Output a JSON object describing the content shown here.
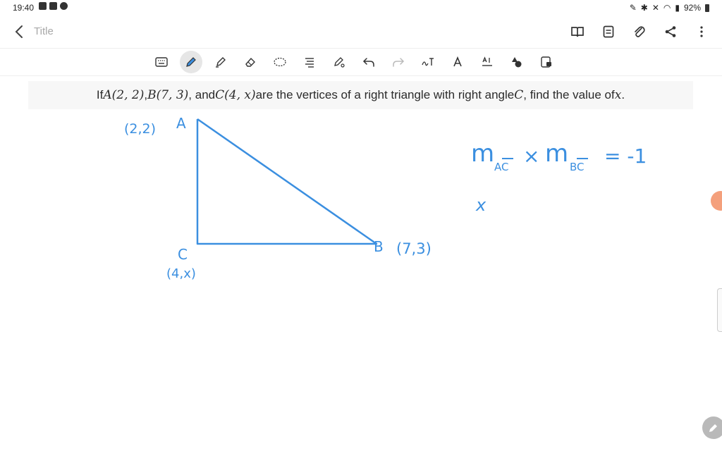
{
  "status": {
    "time": "19:40",
    "battery": "92%"
  },
  "app": {
    "title_placeholder": "Title"
  },
  "toolbar": {
    "tools": [
      "keyboard-icon",
      "pen-icon",
      "highlighter-icon",
      "eraser-icon",
      "lasso-icon",
      "text-align-icon",
      "shape-pen-icon",
      "undo-icon",
      "redo-icon",
      "handwriting-to-text-icon",
      "text-style-icon",
      "text-box-icon",
      "shapes-icon",
      "image-lock-icon"
    ],
    "active_tool": "pen-icon"
  },
  "question": {
    "pre": "If ",
    "A": "A(2, 2)",
    "sep1": ", ",
    "B": "B(7, 3)",
    "sep2": ", and ",
    "C": "C(4, x)",
    "mid": " are the vertices of a right triangle with right angle ",
    "Cangle": "C",
    "post": ", find the value of ",
    "x": "x",
    "end": "."
  },
  "handwriting": {
    "label_A_coord": "(2,2)",
    "label_A": "A",
    "label_B": "B",
    "label_B_coord": "(7,3)",
    "label_C": "C",
    "label_C_coord": "(4,x)",
    "eq_m1": "m",
    "eq_sub1": "AC",
    "eq_times": "×",
    "eq_m2": "m",
    "eq_sub2": "BC",
    "eq_rhs": "= -1",
    "line2": "x"
  },
  "colors": {
    "ink": "#3b8fe0",
    "accent_active": "#e6e6e6"
  }
}
